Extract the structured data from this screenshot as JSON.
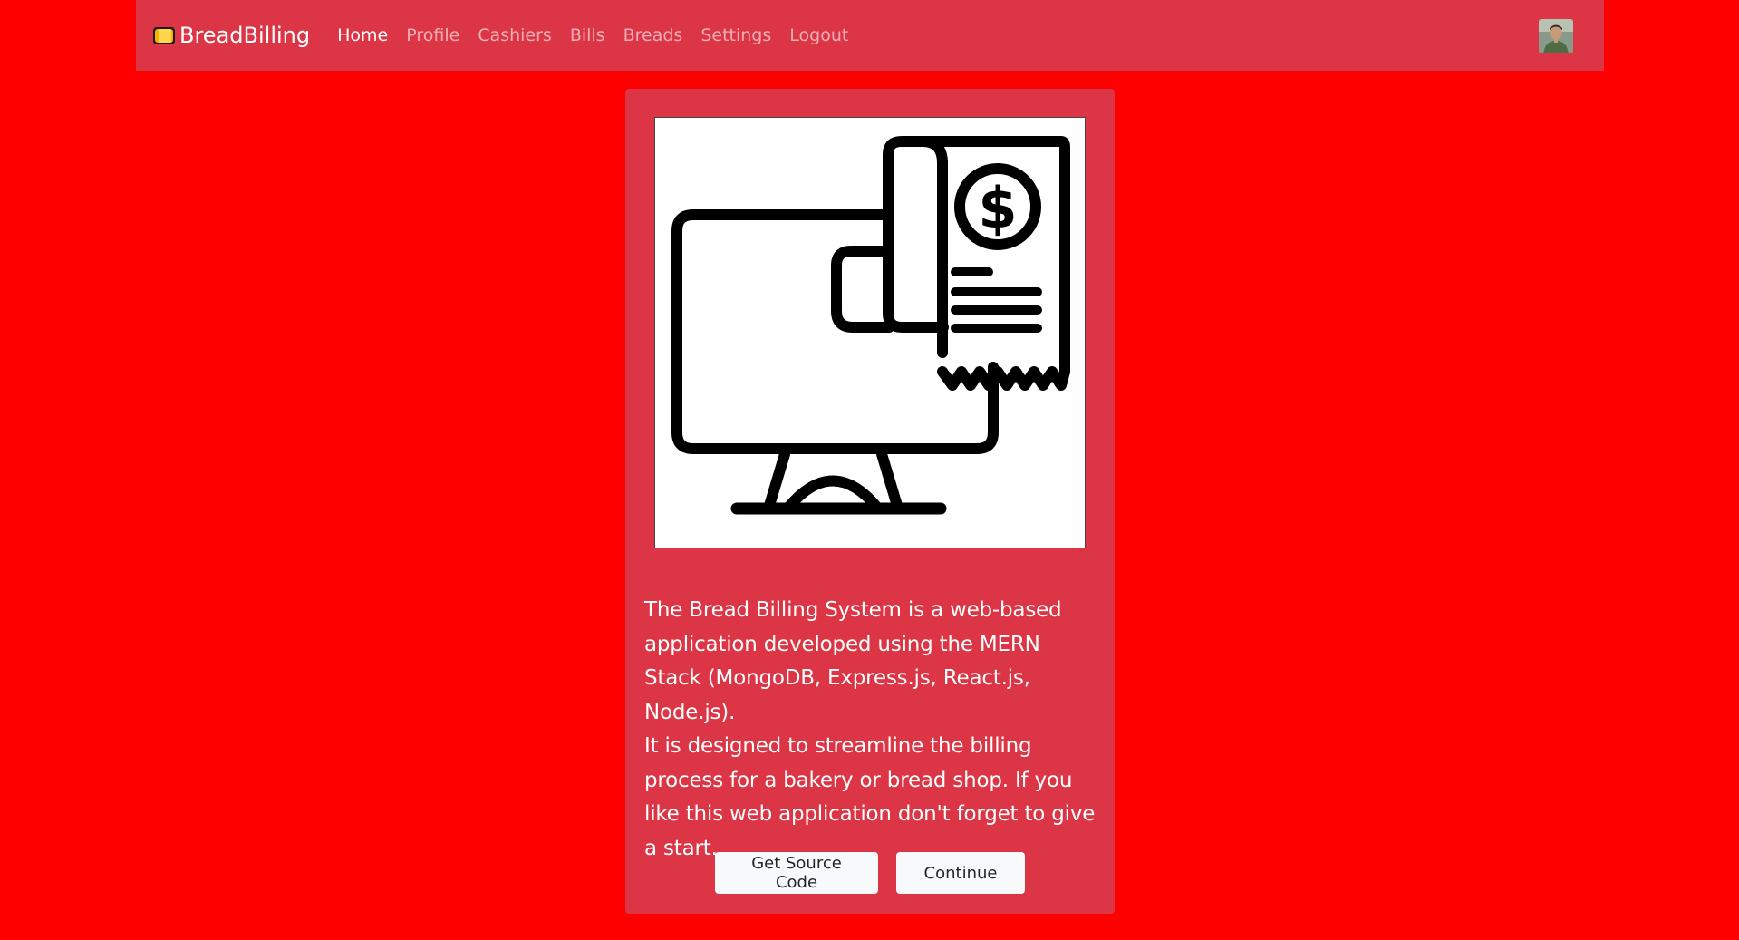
{
  "brand": {
    "name": "BreadBilling",
    "icon": "bread-icon"
  },
  "nav": {
    "items": [
      {
        "label": "Home",
        "active": true
      },
      {
        "label": "Profile",
        "active": false
      },
      {
        "label": "Cashiers",
        "active": false
      },
      {
        "label": "Bills",
        "active": false
      },
      {
        "label": "Breads",
        "active": false
      },
      {
        "label": "Settings",
        "active": false
      },
      {
        "label": "Logout",
        "active": false
      }
    ]
  },
  "user": {
    "avatar": "user-avatar"
  },
  "card": {
    "image": "billing-monitor-receipt-icon",
    "paragraph1": "The Bread Billing System is a web-based application developed using the MERN Stack (MongoDB, Express.js, React.js, Node.js).",
    "paragraph2": "It is designed to streamline the billing process for a bakery or bread shop. If you like this web application don't forget to give a start.",
    "buttons": {
      "source": "Get Source Code",
      "continue": "Continue"
    }
  },
  "colors": {
    "page_background": "#ff0000",
    "primary": "#dc3545",
    "button": "#f8f9fa"
  }
}
